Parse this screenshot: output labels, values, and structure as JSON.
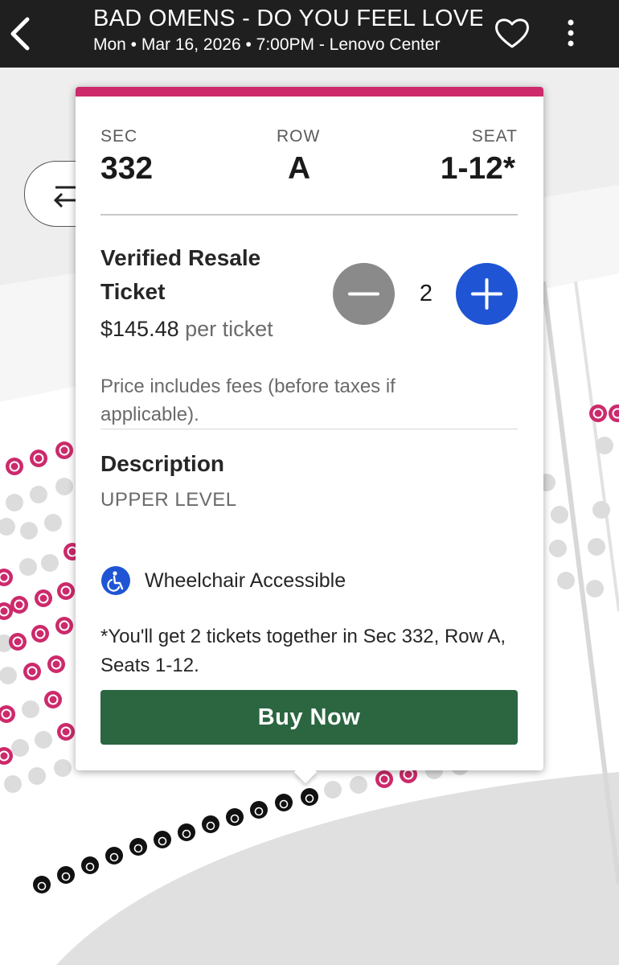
{
  "header": {
    "title": "BAD OMENS - DO YOU FEEL LOVE",
    "subtitle": "Mon • Mar 16, 2026 • 7:00PM - Lenovo Center",
    "back_icon": "chevron-left-icon",
    "favorite_icon": "heart-outline-icon",
    "more_icon": "more-vertical-icon"
  },
  "map": {
    "swap_icon": "arrows-swap-icon",
    "resale_seat_color": "#cc2a6b",
    "standard_seat_color": "#dcdcdc",
    "accessible_seat_color": "#111111"
  },
  "listing": {
    "sec_label": "SEC",
    "sec_value": "332",
    "row_label": "ROW",
    "row_value": "A",
    "seat_label": "SEAT",
    "seat_value": "1-12*",
    "ticket_type": "Verified Resale Ticket",
    "price": "$145.48",
    "price_unit": "per ticket",
    "quantity": "2",
    "fees_note": "Price includes fees (before taxes if applicable).",
    "description_heading": "Description",
    "description_value": "UPPER LEVEL",
    "feature": "Wheelchair Accessible",
    "together_note": "*You'll get 2 tickets together in Sec 332, Row A, Seats 1-12.",
    "buy_label": "Buy Now",
    "accent_color": "#cc2a6b",
    "buy_color": "#2b6641",
    "qty_plus_color": "#1f55d4"
  }
}
